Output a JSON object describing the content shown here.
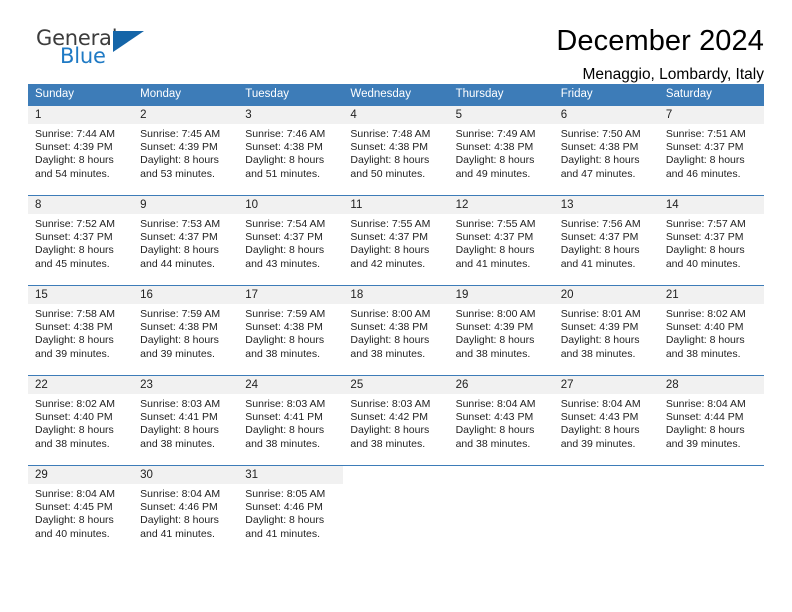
{
  "logo": {
    "word_top": "General",
    "word_bottom": "Blue",
    "triangle_color": "#1565a8",
    "blue_color": "#1f7ac4"
  },
  "header": {
    "title": "December 2024",
    "subtitle": "Menaggio, Lombardy, Italy"
  },
  "theme": {
    "header_blue": "#3d7cb8",
    "daynum_background": "#f1f1f1"
  },
  "weekdays": [
    "Sunday",
    "Monday",
    "Tuesday",
    "Wednesday",
    "Thursday",
    "Friday",
    "Saturday"
  ],
  "weeks": [
    [
      {
        "day": "1",
        "sunrise": "Sunrise: 7:44 AM",
        "sunset": "Sunset: 4:39 PM",
        "daylight": "Daylight: 8 hours and 54 minutes."
      },
      {
        "day": "2",
        "sunrise": "Sunrise: 7:45 AM",
        "sunset": "Sunset: 4:39 PM",
        "daylight": "Daylight: 8 hours and 53 minutes."
      },
      {
        "day": "3",
        "sunrise": "Sunrise: 7:46 AM",
        "sunset": "Sunset: 4:38 PM",
        "daylight": "Daylight: 8 hours and 51 minutes."
      },
      {
        "day": "4",
        "sunrise": "Sunrise: 7:48 AM",
        "sunset": "Sunset: 4:38 PM",
        "daylight": "Daylight: 8 hours and 50 minutes."
      },
      {
        "day": "5",
        "sunrise": "Sunrise: 7:49 AM",
        "sunset": "Sunset: 4:38 PM",
        "daylight": "Daylight: 8 hours and 49 minutes."
      },
      {
        "day": "6",
        "sunrise": "Sunrise: 7:50 AM",
        "sunset": "Sunset: 4:38 PM",
        "daylight": "Daylight: 8 hours and 47 minutes."
      },
      {
        "day": "7",
        "sunrise": "Sunrise: 7:51 AM",
        "sunset": "Sunset: 4:37 PM",
        "daylight": "Daylight: 8 hours and 46 minutes."
      }
    ],
    [
      {
        "day": "8",
        "sunrise": "Sunrise: 7:52 AM",
        "sunset": "Sunset: 4:37 PM",
        "daylight": "Daylight: 8 hours and 45 minutes."
      },
      {
        "day": "9",
        "sunrise": "Sunrise: 7:53 AM",
        "sunset": "Sunset: 4:37 PM",
        "daylight": "Daylight: 8 hours and 44 minutes."
      },
      {
        "day": "10",
        "sunrise": "Sunrise: 7:54 AM",
        "sunset": "Sunset: 4:37 PM",
        "daylight": "Daylight: 8 hours and 43 minutes."
      },
      {
        "day": "11",
        "sunrise": "Sunrise: 7:55 AM",
        "sunset": "Sunset: 4:37 PM",
        "daylight": "Daylight: 8 hours and 42 minutes."
      },
      {
        "day": "12",
        "sunrise": "Sunrise: 7:55 AM",
        "sunset": "Sunset: 4:37 PM",
        "daylight": "Daylight: 8 hours and 41 minutes."
      },
      {
        "day": "13",
        "sunrise": "Sunrise: 7:56 AM",
        "sunset": "Sunset: 4:37 PM",
        "daylight": "Daylight: 8 hours and 41 minutes."
      },
      {
        "day": "14",
        "sunrise": "Sunrise: 7:57 AM",
        "sunset": "Sunset: 4:37 PM",
        "daylight": "Daylight: 8 hours and 40 minutes."
      }
    ],
    [
      {
        "day": "15",
        "sunrise": "Sunrise: 7:58 AM",
        "sunset": "Sunset: 4:38 PM",
        "daylight": "Daylight: 8 hours and 39 minutes."
      },
      {
        "day": "16",
        "sunrise": "Sunrise: 7:59 AM",
        "sunset": "Sunset: 4:38 PM",
        "daylight": "Daylight: 8 hours and 39 minutes."
      },
      {
        "day": "17",
        "sunrise": "Sunrise: 7:59 AM",
        "sunset": "Sunset: 4:38 PM",
        "daylight": "Daylight: 8 hours and 38 minutes."
      },
      {
        "day": "18",
        "sunrise": "Sunrise: 8:00 AM",
        "sunset": "Sunset: 4:38 PM",
        "daylight": "Daylight: 8 hours and 38 minutes."
      },
      {
        "day": "19",
        "sunrise": "Sunrise: 8:00 AM",
        "sunset": "Sunset: 4:39 PM",
        "daylight": "Daylight: 8 hours and 38 minutes."
      },
      {
        "day": "20",
        "sunrise": "Sunrise: 8:01 AM",
        "sunset": "Sunset: 4:39 PM",
        "daylight": "Daylight: 8 hours and 38 minutes."
      },
      {
        "day": "21",
        "sunrise": "Sunrise: 8:02 AM",
        "sunset": "Sunset: 4:40 PM",
        "daylight": "Daylight: 8 hours and 38 minutes."
      }
    ],
    [
      {
        "day": "22",
        "sunrise": "Sunrise: 8:02 AM",
        "sunset": "Sunset: 4:40 PM",
        "daylight": "Daylight: 8 hours and 38 minutes."
      },
      {
        "day": "23",
        "sunrise": "Sunrise: 8:03 AM",
        "sunset": "Sunset: 4:41 PM",
        "daylight": "Daylight: 8 hours and 38 minutes."
      },
      {
        "day": "24",
        "sunrise": "Sunrise: 8:03 AM",
        "sunset": "Sunset: 4:41 PM",
        "daylight": "Daylight: 8 hours and 38 minutes."
      },
      {
        "day": "25",
        "sunrise": "Sunrise: 8:03 AM",
        "sunset": "Sunset: 4:42 PM",
        "daylight": "Daylight: 8 hours and 38 minutes."
      },
      {
        "day": "26",
        "sunrise": "Sunrise: 8:04 AM",
        "sunset": "Sunset: 4:43 PM",
        "daylight": "Daylight: 8 hours and 38 minutes."
      },
      {
        "day": "27",
        "sunrise": "Sunrise: 8:04 AM",
        "sunset": "Sunset: 4:43 PM",
        "daylight": "Daylight: 8 hours and 39 minutes."
      },
      {
        "day": "28",
        "sunrise": "Sunrise: 8:04 AM",
        "sunset": "Sunset: 4:44 PM",
        "daylight": "Daylight: 8 hours and 39 minutes."
      }
    ],
    [
      {
        "day": "29",
        "sunrise": "Sunrise: 8:04 AM",
        "sunset": "Sunset: 4:45 PM",
        "daylight": "Daylight: 8 hours and 40 minutes."
      },
      {
        "day": "30",
        "sunrise": "Sunrise: 8:04 AM",
        "sunset": "Sunset: 4:46 PM",
        "daylight": "Daylight: 8 hours and 41 minutes."
      },
      {
        "day": "31",
        "sunrise": "Sunrise: 8:05 AM",
        "sunset": "Sunset: 4:46 PM",
        "daylight": "Daylight: 8 hours and 41 minutes."
      },
      {
        "day": "",
        "sunrise": "",
        "sunset": "",
        "daylight": ""
      },
      {
        "day": "",
        "sunrise": "",
        "sunset": "",
        "daylight": ""
      },
      {
        "day": "",
        "sunrise": "",
        "sunset": "",
        "daylight": ""
      },
      {
        "day": "",
        "sunrise": "",
        "sunset": "",
        "daylight": ""
      }
    ]
  ]
}
